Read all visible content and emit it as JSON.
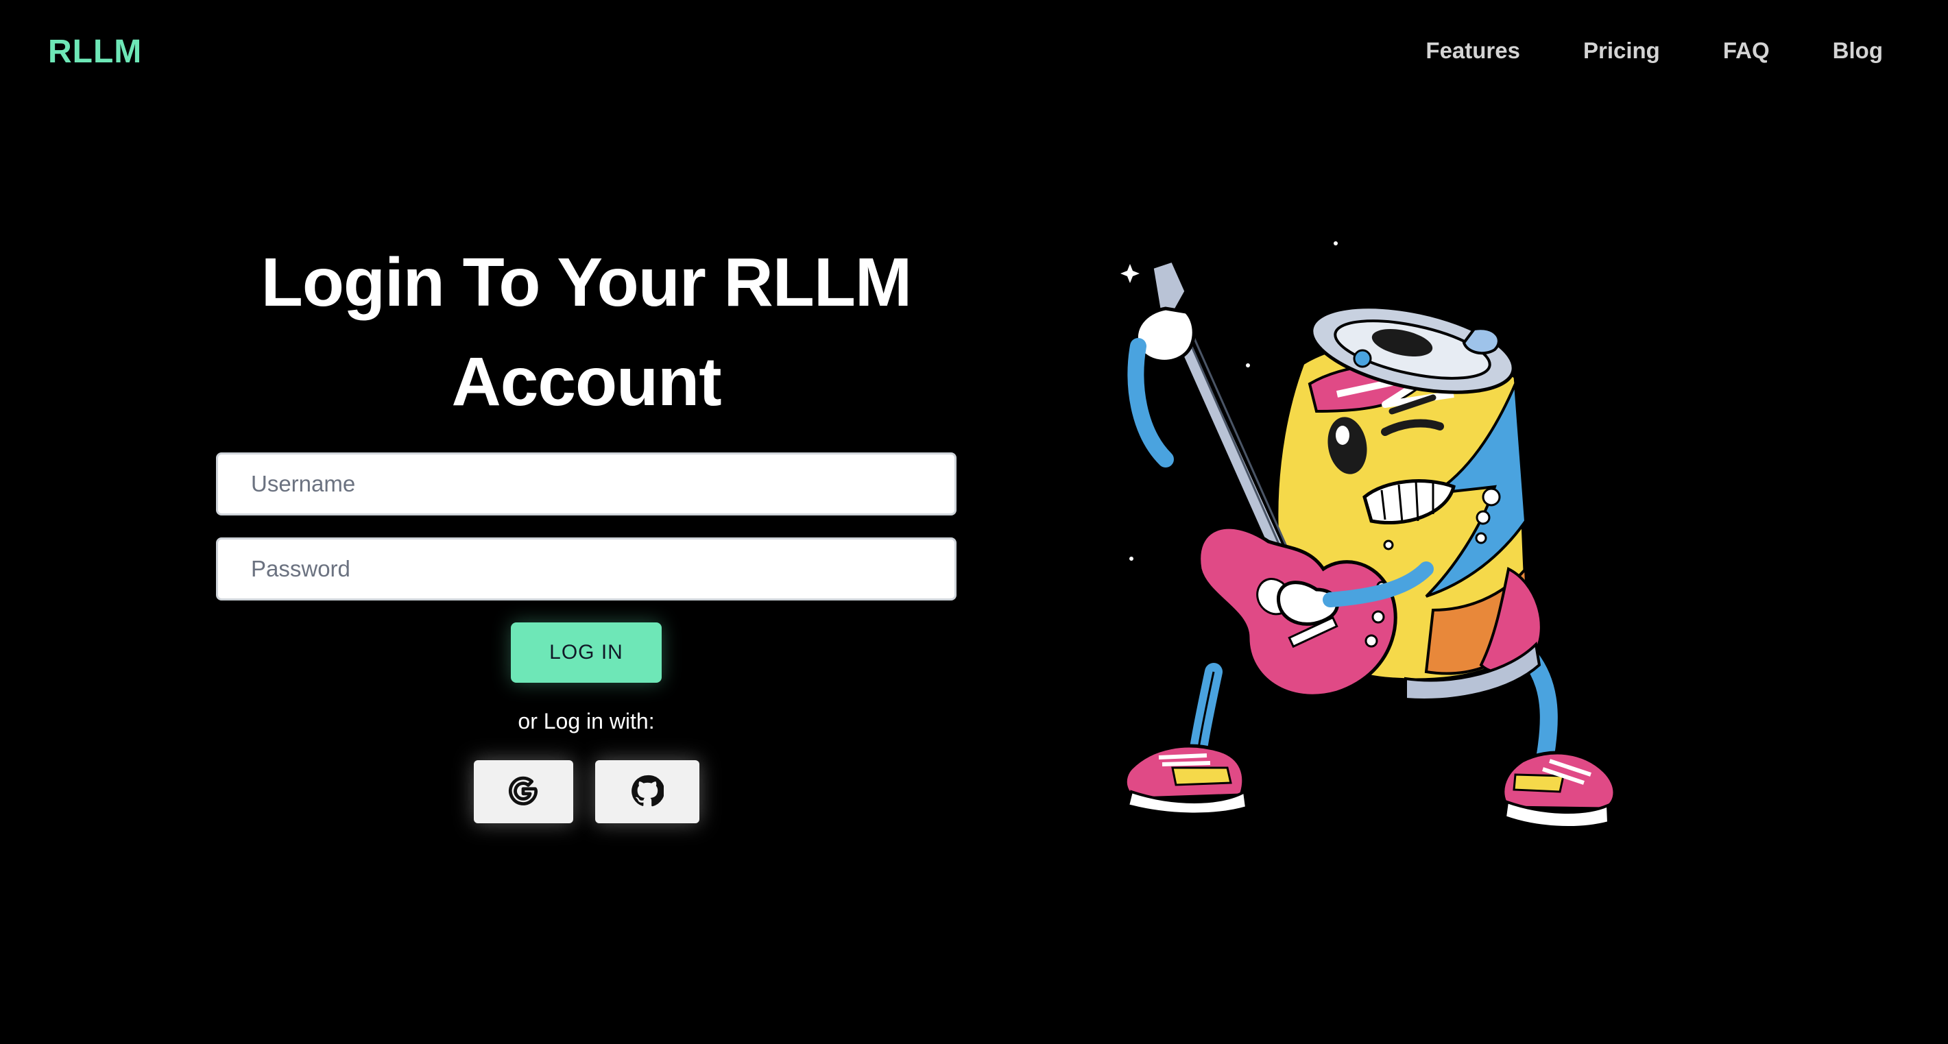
{
  "header": {
    "logo": "RLLM",
    "nav": [
      {
        "label": "Features"
      },
      {
        "label": "Pricing"
      },
      {
        "label": "FAQ"
      },
      {
        "label": "Blog"
      }
    ]
  },
  "login": {
    "title": "Login To Your RLLM Account",
    "username_placeholder": "Username",
    "password_placeholder": "Password",
    "submit_label": "LOG IN",
    "alt_text": "or Log in with:",
    "providers": [
      {
        "name": "Google",
        "icon": "google-icon"
      },
      {
        "name": "GitHub",
        "icon": "github-icon"
      }
    ]
  },
  "illustration": {
    "subject": "cartoon soda can mascot playing electric guitar"
  },
  "colors": {
    "background": "#000000",
    "accent": "#6ee7b7",
    "nav_text": "#d4d4d4",
    "button_bg": "#f1f1f1"
  }
}
